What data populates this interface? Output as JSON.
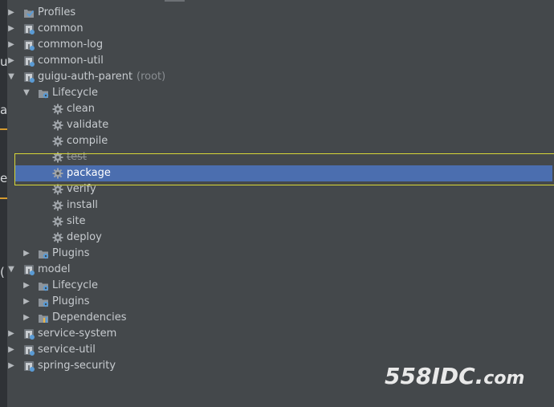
{
  "tree": {
    "rows": [
      {
        "name": "profiles",
        "label": "Profiles",
        "suffix": "",
        "level": 0,
        "state": "collapsed",
        "icon": "profiles-icon",
        "selected": false,
        "strike": false
      },
      {
        "name": "common",
        "label": "common",
        "suffix": "",
        "level": 0,
        "state": "collapsed",
        "icon": "maven-module-icon",
        "selected": false,
        "strike": false
      },
      {
        "name": "common-log",
        "label": "common-log",
        "suffix": "",
        "level": 0,
        "state": "collapsed",
        "icon": "maven-module-icon",
        "selected": false,
        "strike": false
      },
      {
        "name": "common-util",
        "label": "common-util",
        "suffix": "",
        "level": 0,
        "state": "collapsed",
        "icon": "maven-module-icon",
        "selected": false,
        "strike": false
      },
      {
        "name": "guigu-auth-parent",
        "label": "guigu-auth-parent",
        "suffix": "(root)",
        "level": 0,
        "state": "expanded",
        "icon": "maven-module-icon",
        "selected": false,
        "strike": false
      },
      {
        "name": "lifecycle",
        "label": "Lifecycle",
        "suffix": "",
        "level": 1,
        "state": "expanded",
        "icon": "lifecycle-folder-icon",
        "selected": false,
        "strike": false
      },
      {
        "name": "clean",
        "label": "clean",
        "suffix": "",
        "level": 2,
        "state": "leaf",
        "icon": "gear-icon",
        "selected": false,
        "strike": false
      },
      {
        "name": "validate",
        "label": "validate",
        "suffix": "",
        "level": 2,
        "state": "leaf",
        "icon": "gear-icon",
        "selected": false,
        "strike": false
      },
      {
        "name": "compile",
        "label": "compile",
        "suffix": "",
        "level": 2,
        "state": "leaf",
        "icon": "gear-icon",
        "selected": false,
        "strike": false
      },
      {
        "name": "test",
        "label": "test",
        "suffix": "",
        "level": 2,
        "state": "leaf",
        "icon": "gear-icon",
        "selected": false,
        "strike": true
      },
      {
        "name": "package",
        "label": "package",
        "suffix": "",
        "level": 2,
        "state": "leaf",
        "icon": "gear-icon",
        "selected": true,
        "strike": false
      },
      {
        "name": "verify",
        "label": "verify",
        "suffix": "",
        "level": 2,
        "state": "leaf",
        "icon": "gear-icon",
        "selected": false,
        "strike": false
      },
      {
        "name": "install",
        "label": "install",
        "suffix": "",
        "level": 2,
        "state": "leaf",
        "icon": "gear-icon",
        "selected": false,
        "strike": false
      },
      {
        "name": "site",
        "label": "site",
        "suffix": "",
        "level": 2,
        "state": "leaf",
        "icon": "gear-icon",
        "selected": false,
        "strike": false
      },
      {
        "name": "deploy",
        "label": "deploy",
        "suffix": "",
        "level": 2,
        "state": "leaf",
        "icon": "gear-icon",
        "selected": false,
        "strike": false
      },
      {
        "name": "plugins",
        "label": "Plugins",
        "suffix": "",
        "level": 1,
        "state": "collapsed",
        "icon": "plugins-folder-icon",
        "selected": false,
        "strike": false
      },
      {
        "name": "model",
        "label": "model",
        "suffix": "",
        "level": 0,
        "state": "expanded",
        "icon": "maven-module-icon",
        "selected": false,
        "strike": false
      },
      {
        "name": "model-lifecycle",
        "label": "Lifecycle",
        "suffix": "",
        "level": 1,
        "state": "collapsed",
        "icon": "lifecycle-folder-icon",
        "selected": false,
        "strike": false
      },
      {
        "name": "model-plugins",
        "label": "Plugins",
        "suffix": "",
        "level": 1,
        "state": "collapsed",
        "icon": "plugins-folder-icon",
        "selected": false,
        "strike": false
      },
      {
        "name": "model-dependencies",
        "label": "Dependencies",
        "suffix": "",
        "level": 1,
        "state": "collapsed",
        "icon": "dependencies-folder-icon",
        "selected": false,
        "strike": false
      },
      {
        "name": "service-system",
        "label": "service-system",
        "suffix": "",
        "level": 0,
        "state": "collapsed",
        "icon": "maven-module-icon",
        "selected": false,
        "strike": false
      },
      {
        "name": "service-util",
        "label": "service-util",
        "suffix": "",
        "level": 0,
        "state": "collapsed",
        "icon": "maven-module-icon",
        "selected": false,
        "strike": false
      },
      {
        "name": "spring-security",
        "label": "spring-security",
        "suffix": "",
        "level": 0,
        "state": "collapsed",
        "icon": "maven-module-icon",
        "selected": false,
        "strike": false
      }
    ]
  },
  "left_fragments": [
    "u",
    "a",
    "e",
    "("
  ],
  "watermark": {
    "main": "558IDC.",
    "tail": "com"
  },
  "colors": {
    "background": "#44484b",
    "selection": "#4b6eaf",
    "highlight_border": "#d8d838",
    "maven_blue": "#5a9bd5",
    "folder_gray": "#8e949a",
    "gear_gray": "#9ea3a8"
  }
}
